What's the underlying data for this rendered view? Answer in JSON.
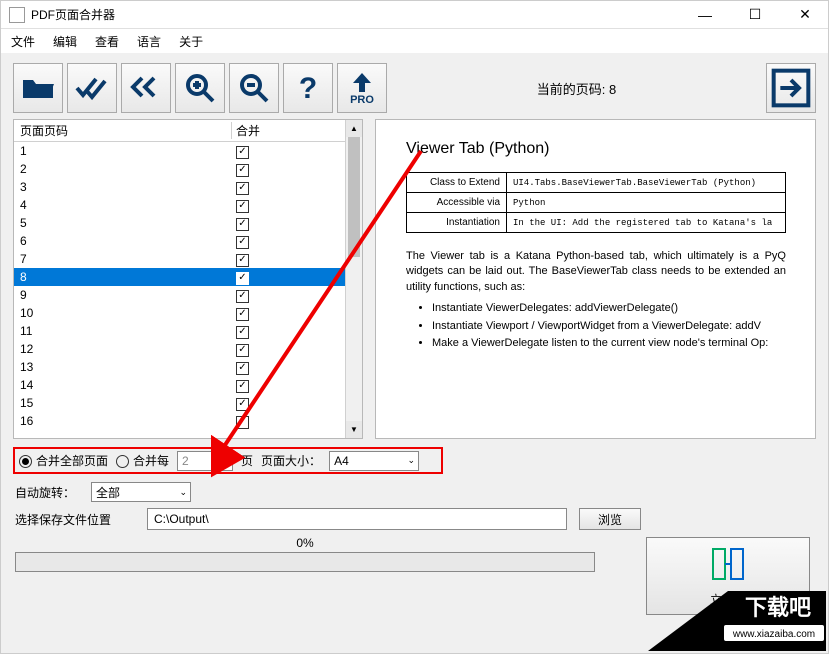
{
  "window": {
    "title": "PDF页面合并器"
  },
  "menu": {
    "file": "文件",
    "edit": "编辑",
    "view": "查看",
    "lang": "语言",
    "about": "关于"
  },
  "toolbar": {
    "open": "open",
    "apply": "apply",
    "undo": "undo",
    "zoomin": "zoom-in",
    "zoomout": "zoom-out",
    "help": "help",
    "pro": "PRO",
    "current_page_label": "当前的页码: 8",
    "exit": "exit"
  },
  "table": {
    "col_page": "页面页码",
    "col_merge": "合并",
    "rows": [
      {
        "n": "1",
        "c": true
      },
      {
        "n": "2",
        "c": true
      },
      {
        "n": "3",
        "c": true
      },
      {
        "n": "4",
        "c": true
      },
      {
        "n": "5",
        "c": true
      },
      {
        "n": "6",
        "c": true
      },
      {
        "n": "7",
        "c": true
      },
      {
        "n": "8",
        "c": true,
        "sel": true
      },
      {
        "n": "9",
        "c": true
      },
      {
        "n": "10",
        "c": true
      },
      {
        "n": "11",
        "c": true
      },
      {
        "n": "12",
        "c": true
      },
      {
        "n": "13",
        "c": true
      },
      {
        "n": "14",
        "c": true
      },
      {
        "n": "15",
        "c": true
      },
      {
        "n": "16",
        "c": true
      }
    ]
  },
  "preview": {
    "title": "Viewer Tab (Python)",
    "t1a": "Class to Extend",
    "t1b": "UI4.Tabs.BaseViewerTab.BaseViewerTab (Python)",
    "t2a": "Accessible via",
    "t2b": "Python",
    "t3a": "Instantiation",
    "t3b": "In the UI: Add the registered tab to Katana's la",
    "para": "The Viewer tab is a Katana Python-based tab, which ultimately is a PyQ widgets can be laid out. The BaseViewerTab class needs to be extended an utility functions, such as:",
    "li1": "Instantiate ViewerDelegates: addViewerDelegate()",
    "li2": "Instantiate Viewport / ViewportWidget from a ViewerDelegate: addV",
    "li3": "Make a ViewerDelegate listen to the current view node's terminal Op:"
  },
  "merge": {
    "opt_all": "合并全部页面",
    "opt_every": "合并每",
    "every_n": "2",
    "pages_suffix": "页",
    "size_label": "页面大小：",
    "size_value": "A4"
  },
  "rotate": {
    "label": "自动旋转：",
    "value": "全部"
  },
  "save": {
    "label": "选择保存文件位置",
    "path": "C:\\Output\\",
    "browse": "浏览"
  },
  "progress": {
    "text": "0%"
  },
  "run": {
    "label": "立刻…"
  },
  "watermark": {
    "site": "www.xiazaiba.com",
    "brand": "下载吧"
  }
}
